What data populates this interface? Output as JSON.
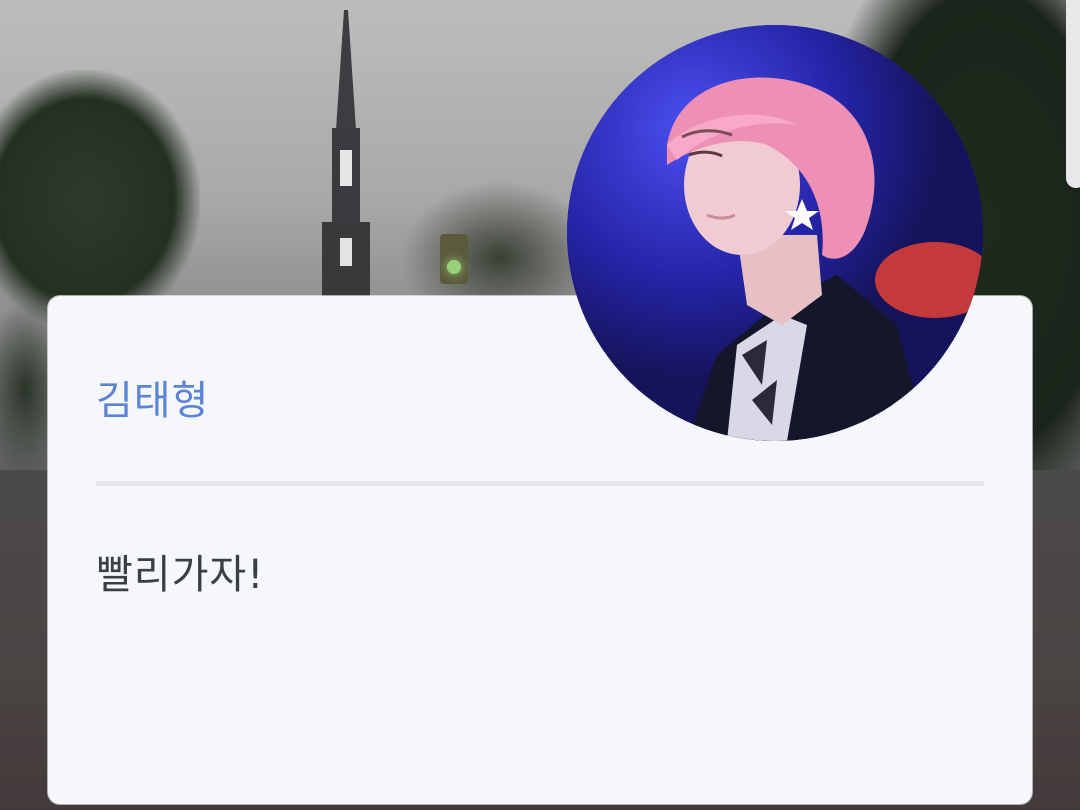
{
  "profile": {
    "name": "김태형",
    "message": "빨리가자!"
  },
  "colors": {
    "name_text": "#5c84d6",
    "message_text": "#3a3f46",
    "card_background": "#f5f7fa",
    "divider": "#e4e6ea",
    "avatar_background": "#2a2bb0",
    "hair": "#ee8fb5"
  },
  "icons": {
    "avatar": "profile-photo",
    "background": "street-photo"
  }
}
